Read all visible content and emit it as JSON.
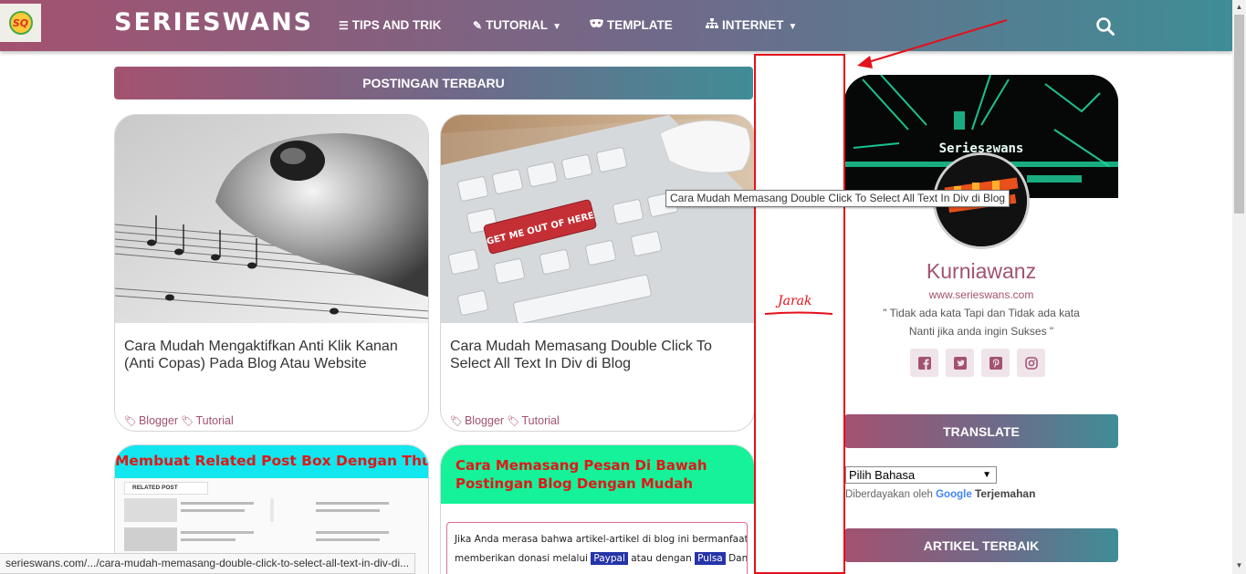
{
  "colors": {
    "brand_start": "#a3526f",
    "brand_mid": "#6f6a8a",
    "brand_end": "#3f8d96",
    "annotation": "#e4101a"
  },
  "nav": {
    "logo_text": "SQ",
    "brand": "SERIESWANS",
    "items": [
      {
        "label": "TIPS AND TRIK",
        "icon": "list-icon",
        "dropdown": false
      },
      {
        "label": "TUTORIAL",
        "icon": "edit-icon",
        "dropdown": true
      },
      {
        "label": "TEMPLATE",
        "icon": "mask-icon",
        "dropdown": false
      },
      {
        "label": "INTERNET",
        "icon": "sitemap-icon",
        "dropdown": true
      }
    ],
    "search_icon": "search-icon"
  },
  "main": {
    "section_title": "POSTINGAN TERBARU",
    "posts": [
      {
        "title": "Cara Mudah Mengaktifkan Anti Klik Kanan (Anti Copas) Pada Blog Atau Website",
        "labels": [
          "Blogger",
          "Tutorial"
        ],
        "thumb_icon": "mouse-sheet-music-image"
      },
      {
        "title": "Cara Mudah Memasang Double Click To Select All Text In Div di Blog",
        "labels": [
          "Blogger",
          "Tutorial"
        ],
        "thumb_icon": "keyboard-image",
        "key_text": "GET ME OUT OF HERE"
      },
      {
        "banner_text": "Membuat Related Post Box Dengan Thumbnail",
        "inner_heading": "RELATED POST"
      },
      {
        "banner_text": "Cara Memasang Pesan Di Bawah Postingan Blog Dengan Mudah",
        "body_text_1": "Jika Anda merasa bahwa artikel-artikel di blog ini bermanfaat, Anda bisa",
        "body_text_2a": "memberikan donasi melalui",
        "chip_1": "Paypal",
        "body_text_2b": "atau dengan",
        "chip_2": "Pulsa",
        "body_text_2c": "Dana hasil dari donasi"
      }
    ]
  },
  "sidebar": {
    "profile": {
      "banner_text": "Seriesƨwans",
      "name": "Kurniawanz",
      "url": "www.serieswans.com",
      "quote_1": "\" Tidak ada kata Tapi dan Tidak ada kata",
      "quote_2": "Nanti jika anda ingin Sukses \"",
      "social": [
        "facebook-icon",
        "twitter-icon",
        "pinterest-icon",
        "instagram-icon"
      ]
    },
    "translate": {
      "title": "TRANSLATE",
      "select_value": "Pilih Bahasa",
      "powered_prefix": "Diberdayakan oleh",
      "google": "Google",
      "link": "Terjemahan"
    },
    "best_title": "ARTIKEL TERBAIK"
  },
  "annotation": {
    "label": "Jarak"
  },
  "tooltip": "Cara Mudah Memasang Double Click To Select All Text In Div di Blog",
  "status_bar": "serieswans.com/.../cara-mudah-memasang-double-click-to-select-all-text-in-div-di..."
}
